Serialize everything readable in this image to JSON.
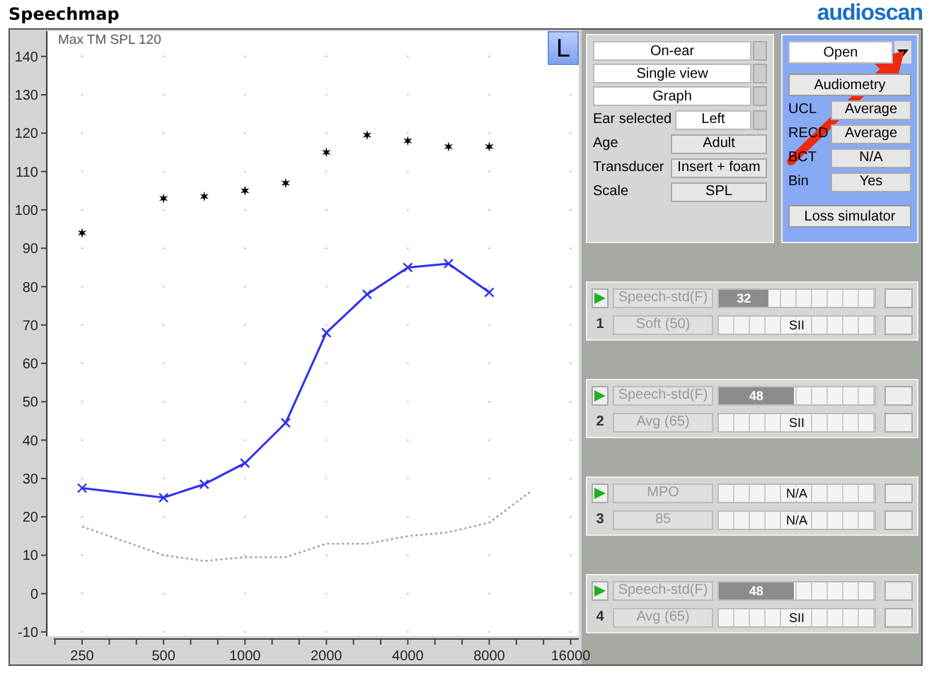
{
  "title": "Speechmap",
  "logo": "audioscan",
  "chart": {
    "caption": "Max TM SPL 120",
    "ear_badge": "L",
    "chart_data": {
      "type": "line",
      "categories": [
        "250",
        null,
        "500",
        null,
        "1000",
        null,
        "2000",
        null,
        "4000",
        null,
        "8000",
        null,
        "16000"
      ],
      "yticks": [
        -10,
        0,
        10,
        20,
        30,
        40,
        50,
        60,
        70,
        80,
        90,
        100,
        110,
        120,
        130,
        140
      ],
      "ylim": [
        -11.1,
        146.6
      ],
      "series": [
        {
          "type": "scatter",
          "color": "#000000",
          "marker": "cross",
          "values": [
            94,
            null,
            103,
            103.5,
            105,
            107,
            115,
            119.5,
            118,
            116.5,
            116.5,
            null,
            null
          ]
        },
        {
          "color": "#3030f0",
          "line_style": "solid",
          "marker": "x",
          "values": [
            27.5,
            null,
            25,
            28.5,
            34,
            44.5,
            68,
            78,
            85,
            86,
            78.5,
            null,
            null
          ]
        },
        {
          "color": "#a0a0a0",
          "line_style": "dotted",
          "marker": "none",
          "values": [
            17.5,
            null,
            10,
            8.5,
            9.5,
            9.5,
            13,
            13,
            15,
            16,
            18.5,
            26.5,
            null
          ]
        }
      ]
    }
  },
  "setup": {
    "buttons": [
      "On-ear",
      "Single view",
      "Graph"
    ],
    "fields": [
      {
        "label": "Ear selected",
        "value": "Left",
        "kind": "dropdown"
      },
      {
        "label": "Age",
        "value": "Adult",
        "kind": "readonly"
      },
      {
        "label": "Transducer",
        "value": "Insert + foam",
        "kind": "readonly"
      },
      {
        "label": "Scale",
        "value": "SPL",
        "kind": "readonly"
      }
    ]
  },
  "audiometry": {
    "mode": "Open",
    "button": "Audiometry",
    "fields": [
      {
        "label": "UCL",
        "value": "Average"
      },
      {
        "label": "RECD",
        "value": "Average"
      },
      {
        "label": "BCT",
        "value": "N/A"
      },
      {
        "label": "Bin",
        "value": "Yes"
      }
    ],
    "loss_button": "Loss simulator"
  },
  "tests": [
    {
      "number": "1",
      "stimulus": "Speech-std(F)",
      "stim_level": "Soft (50)",
      "reading": "32",
      "level": 0.32,
      "result": "SII"
    },
    {
      "number": "2",
      "stimulus": "Speech-std(F)",
      "stim_level": "Avg (65)",
      "reading": "48",
      "level": 0.48,
      "result": "SII"
    },
    {
      "number": "3",
      "stimulus": "MPO",
      "stim_level": "85",
      "reading": "N/A",
      "result": "N/A"
    },
    {
      "number": "4",
      "stimulus": "Speech-std(F)",
      "stim_level": "Avg (65)",
      "reading": "48",
      "level": 0.48,
      "result": "SII"
    }
  ]
}
